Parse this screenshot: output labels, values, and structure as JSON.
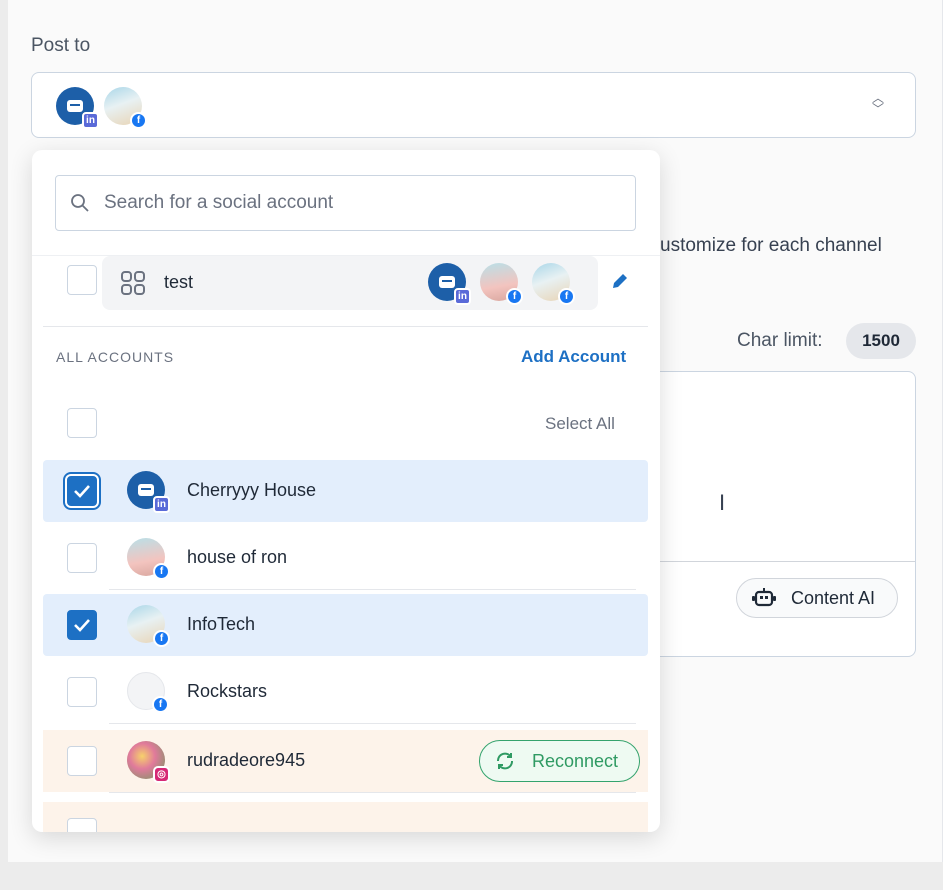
{
  "post_to": {
    "label": "Post to",
    "selected_avatars": [
      {
        "icon": "chat-logo-avatar",
        "platform": "linkedin"
      },
      {
        "icon": "beach-photo-avatar",
        "platform": "facebook"
      }
    ]
  },
  "background": {
    "customize_text": "ustomize for each channel",
    "char_limit_label": "Char limit:",
    "char_limit_value": "1500",
    "content_ai_label": "Content AI"
  },
  "dropdown": {
    "search_placeholder": "Search for a social account",
    "group": {
      "name": "test",
      "avatars": [
        "chat-logo-avatar",
        "pink-photo-avatar",
        "beach-photo-avatar"
      ]
    },
    "section_label": "ALL ACCOUNTS",
    "add_account_label": "Add Account",
    "select_all_label": "Select All",
    "accounts": [
      {
        "name": "Cherryyy House",
        "checked": true,
        "platform": "linkedin"
      },
      {
        "name": "house of ron",
        "checked": false,
        "platform": "facebook"
      },
      {
        "name": "InfoTech",
        "checked": true,
        "platform": "facebook"
      },
      {
        "name": "Rockstars",
        "checked": false,
        "platform": "facebook"
      },
      {
        "name": "rudradeore945",
        "checked": false,
        "platform": "instagram",
        "action": "Reconnect"
      }
    ]
  },
  "colors": {
    "accent": "#1d70c4",
    "selected_row": "#e3eefc",
    "warning_row": "#fdf3ea",
    "reconnect_green": "#2f9a63"
  }
}
